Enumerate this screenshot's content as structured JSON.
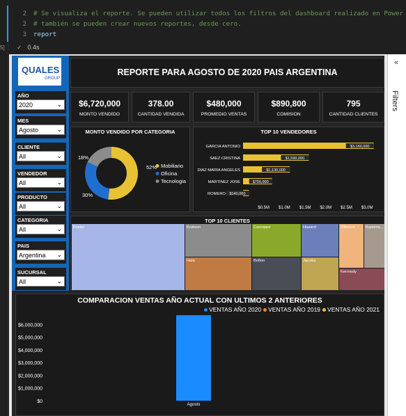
{
  "notebook": {
    "lines": [
      {
        "num": "2",
        "text": "# Se visualiza el reporte. Se pueden utilizar todos los filtros del dashboard realizado en Power BI",
        "kind": "comment"
      },
      {
        "num": "2",
        "text": "# también se pueden crear nuevos reportes, desde cero.",
        "kind": "comment"
      },
      {
        "num": "3",
        "text": "report",
        "kind": "code"
      }
    ],
    "status_time": "0.4s",
    "side_label": "5]"
  },
  "filters_pane": {
    "label": "Filters",
    "collapse_icon": "double-chevron-left"
  },
  "logo": {
    "main": "QUALES",
    "sub": "GROUP"
  },
  "slicers": [
    {
      "title": "AÑO",
      "value": "2020"
    },
    {
      "title": "MES",
      "value": "Agosto"
    },
    {
      "title": "CLIENTE",
      "value": "All"
    },
    {
      "title": "VENDEDOR",
      "value": "All"
    },
    {
      "title": "PRODUCTO",
      "value": "All"
    },
    {
      "title": "CATEGORIA",
      "value": "All"
    },
    {
      "title": "PAIS",
      "value": "Argentina"
    },
    {
      "title": "SUCURSAL",
      "value": "All"
    }
  ],
  "report_title": "REPORTE PARA AGOSTO DE 2020 PAIS ARGENTINA",
  "kpis": [
    {
      "value": "$6,720,000",
      "label": "MONTO VENDIDO"
    },
    {
      "value": "378.00",
      "label": "CANTIDAD VENDIDA"
    },
    {
      "value": "$480,000",
      "label": "PROMEDIO VENTAS"
    },
    {
      "value": "$890,800",
      "label": "COMISION"
    },
    {
      "value": "795",
      "label": "CANTIDAD CLIENTES"
    }
  ],
  "donut": {
    "title": "MONTO VENDIDO POR CATEGORIA",
    "slices": [
      {
        "name": "Mobiliario",
        "pct": 52,
        "label": "52%",
        "color": "#e8c233"
      },
      {
        "name": "Oficina",
        "pct": 30,
        "label": "30%",
        "color": "#1f6fd0"
      },
      {
        "name": "Tecnologia",
        "pct": 18,
        "label": "18%",
        "color": "#8c8c8c"
      }
    ]
  },
  "top_vendedores": {
    "title": "TOP 10 VENDEDORES",
    "bars": [
      {
        "name": "GARCIA ANTONIO",
        "value": 3160000,
        "label": "$3,160,000"
      },
      {
        "name": "SAEZ CRISTINA",
        "value": 1590000,
        "label": "$1,590,000"
      },
      {
        "name": "DIAZ MARIA ANGELES",
        "value": 1130000,
        "label": "$1,130,000"
      },
      {
        "name": "MARTINEZ JOSE",
        "value": 700000,
        "label": "$700,000"
      },
      {
        "name": "ROMERO LAURA",
        "value": 140000,
        "label": "$140,000"
      }
    ],
    "ticks": [
      "$0.5M",
      "$1.0M",
      "$1.5M",
      "$2.0M",
      "$2.5M",
      "$3.0M"
    ],
    "bar_color": "#e8c233"
  },
  "top_clientes": {
    "title": "TOP 10 CLIENTES",
    "cells": [
      {
        "name": "Foster",
        "color": "#a7b6e8"
      },
      {
        "name": "Krutson",
        "color": "#8c8c8c"
      },
      {
        "name": "Cacioppo",
        "color": "#8aa92a"
      },
      {
        "name": "Hazard",
        "color": "#6c7fbb"
      },
      {
        "name": "Olbrient",
        "color": "#f0b47c"
      },
      {
        "name": "Kastens...",
        "color": "#a69a8f"
      },
      {
        "name": "Hale",
        "color": "#c07b45"
      },
      {
        "name": "Bolton",
        "color": "#4a4d56"
      },
      {
        "name": "Jacobs",
        "color": "#c0a653"
      },
      {
        "name": "Kennedy",
        "color": "#8a4a56"
      }
    ]
  },
  "comparacion": {
    "title": "COMPARACION VENTAS AÑO ACTUAL CON ULTIMOS 2 ANTERIORES",
    "legend": [
      {
        "name": "VENTAS AÑO 2020",
        "color": "#1a8cff"
      },
      {
        "name": "VENTAS AÑO 2019",
        "color": "#f08a1a"
      },
      {
        "name": "VENTAS AÑO 2021",
        "color": "#e8c233"
      }
    ]
  },
  "chart_data": [
    {
      "type": "pie",
      "title": "MONTO VENDIDO POR CATEGORIA",
      "categories": [
        "Mobiliario",
        "Oficina",
        "Tecnologia"
      ],
      "values": [
        52,
        30,
        18
      ]
    },
    {
      "type": "bar",
      "title": "TOP 10 VENDEDORES",
      "categories": [
        "GARCIA ANTONIO",
        "SAEZ CRISTINA",
        "DIAZ MARIA ANGELES",
        "MARTINEZ JOSE",
        "ROMERO LAURA"
      ],
      "values": [
        3160000,
        1590000,
        1130000,
        700000,
        140000
      ],
      "xlim": [
        0,
        3300000
      ]
    },
    {
      "type": "bar",
      "title": "COMPARACION VENTAS AÑO ACTUAL CON ULTIMOS 2 ANTERIORES",
      "categories": [
        "Agosto"
      ],
      "series": [
        {
          "name": "VENTAS AÑO 2020",
          "values": [
            6720000
          ]
        },
        {
          "name": "VENTAS AÑO 2019",
          "values": [
            0
          ]
        },
        {
          "name": "VENTAS AÑO 2021",
          "values": [
            0
          ]
        }
      ],
      "ylim": [
        0,
        7000000
      ],
      "yticks": [
        "$0",
        "$1,000,000",
        "$2,000,000",
        "$3,000,000",
        "$4,000,000",
        "$5,000,000",
        "$6,000,000"
      ]
    }
  ]
}
